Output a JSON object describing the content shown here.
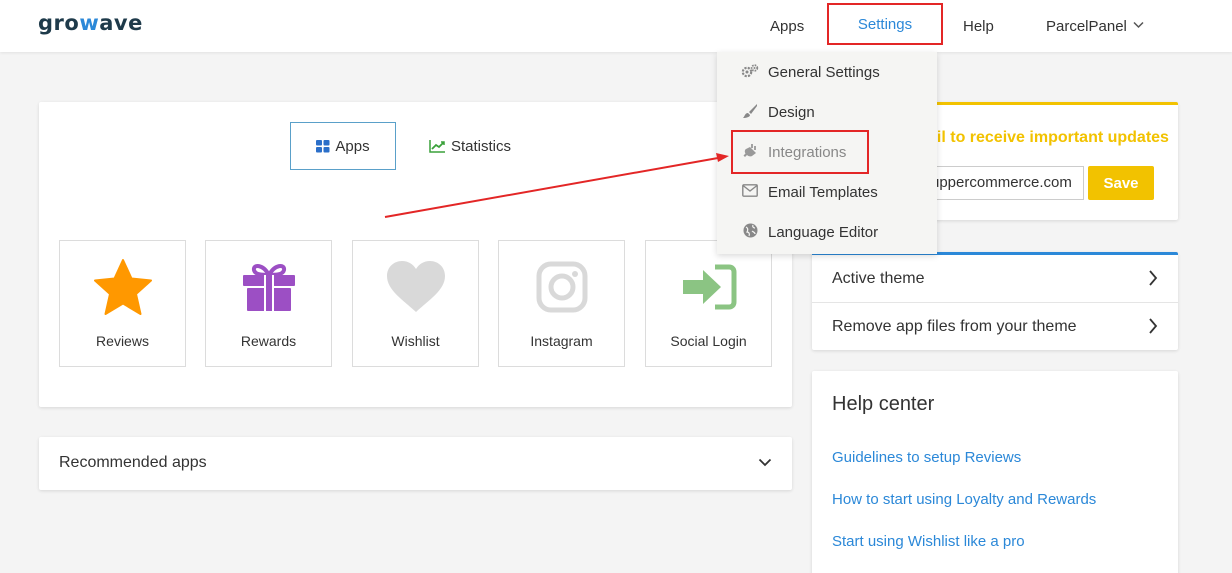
{
  "header": {
    "logo": {
      "pre": "gro",
      "w": "w",
      "post": "ave"
    },
    "nav": {
      "apps": "Apps",
      "settings": "Settings",
      "help": "Help",
      "account": "ParcelPanel"
    }
  },
  "settings_menu": {
    "items": [
      {
        "label": "General Settings",
        "icon": "gears-icon"
      },
      {
        "label": "Design",
        "icon": "brush-icon"
      },
      {
        "label": "Integrations",
        "icon": "plug-icon"
      },
      {
        "label": "Email Templates",
        "icon": "envelope-icon"
      },
      {
        "label": "Language Editor",
        "icon": "globe-icon"
      }
    ]
  },
  "main": {
    "tabs": {
      "apps": "Apps",
      "statistics": "Statistics"
    },
    "apps": [
      {
        "label": "Reviews",
        "icon": "star-icon",
        "color": "#ff9800"
      },
      {
        "label": "Rewards",
        "icon": "gift-icon",
        "color": "#9c4fc4"
      },
      {
        "label": "Wishlist",
        "icon": "heart-icon",
        "color": "#d9d9d9"
      },
      {
        "label": "Instagram",
        "icon": "instagram-icon",
        "color": "#d9d9d9"
      },
      {
        "label": "Social Login",
        "icon": "sign-in-icon",
        "color": "#8bc483"
      }
    ]
  },
  "recommended": {
    "title": "Recommended apps"
  },
  "email_card": {
    "text": "ail to receive important updates",
    "input_value": "uppercommerce.com",
    "save_label": "Save"
  },
  "theme_card": {
    "active_theme": "Active theme",
    "remove_files": "Remove app files from your theme"
  },
  "help_center": {
    "title": "Help center",
    "links": [
      "Guidelines to setup Reviews",
      "How to start using Loyalty and Rewards",
      "Start using Wishlist like a pro"
    ]
  },
  "colors": {
    "accent_blue": "#2b88d8",
    "accent_yellow": "#f2c200",
    "highlight_red": "#e32626"
  }
}
